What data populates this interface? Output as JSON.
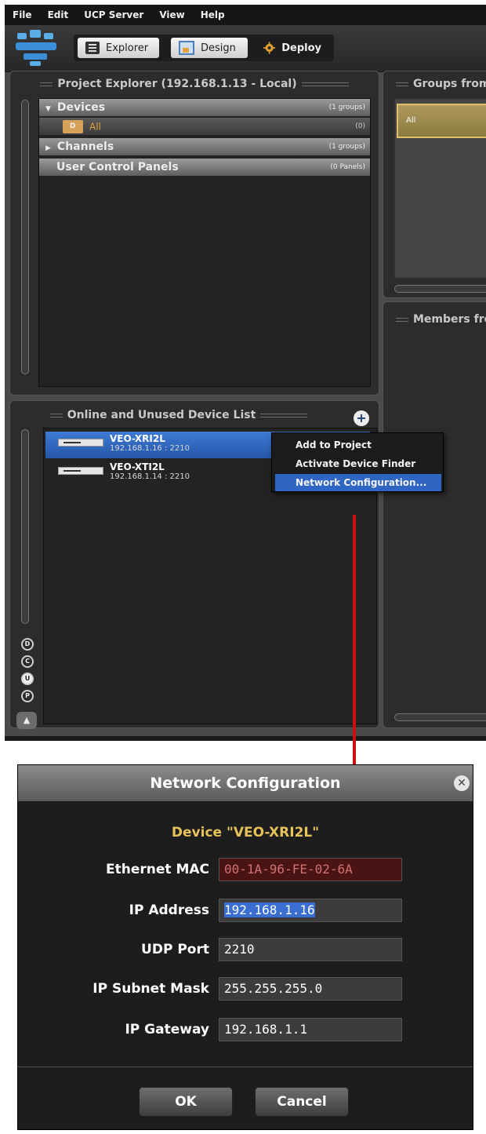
{
  "menu": [
    "File",
    "Edit",
    "UCP Server",
    "View",
    "Help"
  ],
  "toolbar": {
    "explorer": "Explorer",
    "design": "Design",
    "deploy": "Deploy"
  },
  "project_explorer": {
    "title": "Project Explorer (192.168.1.13 - Local)",
    "rows": [
      {
        "label": "Devices",
        "count": "(1 groups)"
      },
      {
        "label": "All",
        "count": "(0)"
      },
      {
        "label": "Channels",
        "count": "(1 groups)"
      },
      {
        "label": "User Control Panels",
        "count": "(0 Panels)"
      }
    ]
  },
  "groups_panel": {
    "title": "Groups from",
    "item": "All"
  },
  "members_panel": {
    "title": "Members fro"
  },
  "device_list": {
    "title": "Online and Unused Device List",
    "devices": [
      {
        "name": "VEO-XRI2L",
        "address": "192.168.1.16 : 2210"
      },
      {
        "name": "VEO-XTI2L",
        "address": "192.168.1.14 : 2210"
      }
    ],
    "side_buttons": [
      "D",
      "C",
      "U",
      "P"
    ]
  },
  "context_menu": [
    "Add to Project",
    "Activate Device Finder",
    "Network Configuration..."
  ],
  "colors": {
    "selection": "#2f66c4",
    "device_title": "#e6c35a",
    "arrow": "#cc1010"
  },
  "dialog": {
    "title": "Network Configuration",
    "device_label": "Device \"VEO-XRI2L\"",
    "fields": [
      {
        "label": "Ethernet MAC",
        "value": "00-1A-96-FE-02-6A"
      },
      {
        "label": "IP Address",
        "value": "192.168.1.16"
      },
      {
        "label": "UDP Port",
        "value": "2210"
      },
      {
        "label": "IP Subnet Mask",
        "value": "255.255.255.0"
      },
      {
        "label": "IP Gateway",
        "value": "192.168.1.1"
      }
    ],
    "ok": "OK",
    "cancel": "Cancel"
  }
}
